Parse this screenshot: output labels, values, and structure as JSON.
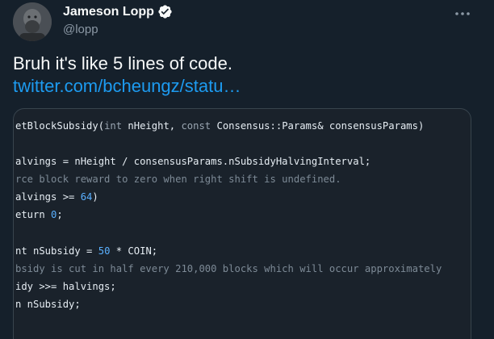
{
  "author": {
    "name": "Jameson Lopp",
    "handle": "@lopp"
  },
  "tweet": {
    "text": "Bruh it's like 5 lines of code.",
    "link": "twitter.com/bcheungz/statu…"
  },
  "code": {
    "lines": [
      [
        {
          "t": "etBlockSubsidy("
        },
        {
          "t": "int",
          "c": "kw"
        },
        {
          "t": " nHeight, "
        },
        {
          "t": "const",
          "c": "kw"
        },
        {
          "t": " Consensus::Params& consensusParams)"
        }
      ],
      [],
      [
        {
          "t": "alvings = nHeight / consensusParams.nSubsidyHalvingInterval;"
        }
      ],
      [
        {
          "t": "rce block reward to zero when right shift is undefined.",
          "c": "cm"
        }
      ],
      [
        {
          "t": "alvings >= "
        },
        {
          "t": "64",
          "c": "num"
        },
        {
          "t": ")"
        }
      ],
      [
        {
          "t": "eturn "
        },
        {
          "t": "0",
          "c": "num"
        },
        {
          "t": ";"
        }
      ],
      [],
      [
        {
          "t": "nt nSubsidy = "
        },
        {
          "t": "50",
          "c": "num"
        },
        {
          "t": " * COIN;"
        }
      ],
      [
        {
          "t": "bsidy is cut in half every 210,000 blocks which will occur approximately",
          "c": "cm"
        }
      ],
      [
        {
          "t": "idy >>= halvings;"
        }
      ],
      [
        {
          "t": "n nSubsidy;"
        }
      ]
    ]
  },
  "colors": {
    "background": "#15202b",
    "link": "#1d9bf0",
    "verified": "#1d9bf0",
    "number_literal": "#5ab0ff"
  },
  "icons": {
    "verified": "verified-badge-icon",
    "more": "more-options-icon"
  }
}
